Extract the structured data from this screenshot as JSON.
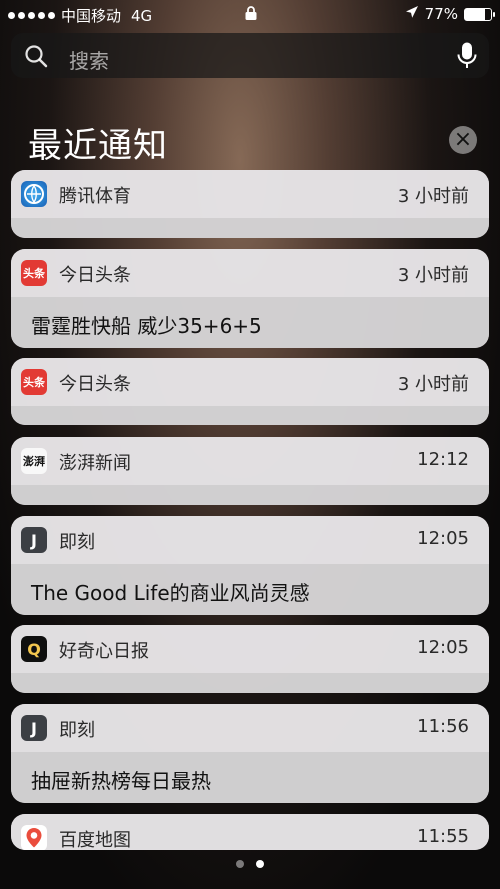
{
  "status_bar": {
    "carrier": "中国移动",
    "network": "4G",
    "battery_percent": "77%",
    "battery_level": 0.77
  },
  "search": {
    "placeholder": "搜索"
  },
  "notifications_section": {
    "title": "最近通知",
    "clear_label": "×"
  },
  "notifications": [
    {
      "app": "腾讯体育",
      "time": "3 小时前",
      "text": "",
      "icon": "tencent-sports-icon"
    },
    {
      "app": "今日头条",
      "time": "3 小时前",
      "text": "雷霆胜快船 威少35+6+5",
      "icon": "toutiao-icon"
    },
    {
      "app": "今日头条",
      "time": "3 小时前",
      "text": "",
      "icon": "toutiao-icon"
    },
    {
      "app": "澎湃新闻",
      "time": "12:12",
      "text": "",
      "icon": "pengpai-icon"
    },
    {
      "app": "即刻",
      "time": "12:05",
      "text": "The Good Life的商业风尚灵感",
      "icon": "jike-icon"
    },
    {
      "app": "好奇心日报",
      "time": "12:05",
      "text": "",
      "icon": "qdaily-icon"
    },
    {
      "app": "即刻",
      "time": "11:56",
      "text": "抽屉新热榜每日最热",
      "icon": "jike-icon"
    },
    {
      "app": "百度地图",
      "time": "11:55",
      "text": "",
      "icon": "baidu-map-icon"
    }
  ],
  "page_indicator": {
    "count": 2,
    "active_index": 1
  },
  "colors": {
    "card_background": "#d6d4d6",
    "toutiao_red": "#e23a34",
    "jike_dark": "#3c3f44",
    "qdaily_gold": "#f3c64f"
  }
}
